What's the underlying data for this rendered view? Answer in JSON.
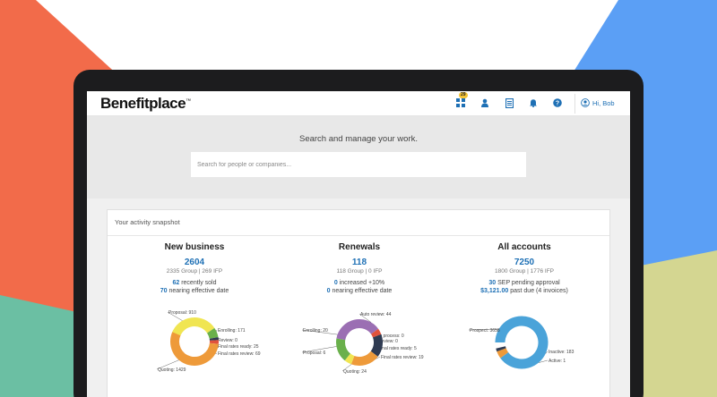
{
  "app": {
    "logo": "Benefitplace",
    "logo_mark": "™"
  },
  "header": {
    "badge": "29",
    "user_label": "Hi, Bob"
  },
  "hero": {
    "title": "Search and manage your work.",
    "search_placeholder": "Search for people or companies..."
  },
  "snapshot": {
    "title": "Your activity snapshot",
    "new_business": {
      "title": "New business",
      "count": "2604",
      "sub": "2335 Group | 269 IFP",
      "line1_num": "62",
      "line1_text": " recently sold",
      "line2_num": "70",
      "line2_text": " nearing effective date",
      "segments": [
        {
          "label": "Proposal: 910",
          "value": 910,
          "color": "#f0e552"
        },
        {
          "label": "Enrolling: 171",
          "value": 171,
          "color": "#6ab04c"
        },
        {
          "label": "Review: 0",
          "value": 0,
          "color": "#999999"
        },
        {
          "label": "Final rates ready: 25",
          "value": 25,
          "color": "#2f3b52"
        },
        {
          "label": "Final rates review: 69",
          "value": 69,
          "color": "#e0523c"
        },
        {
          "label": "Quoting: 1429",
          "value": 1429,
          "color": "#ee9a3a"
        }
      ]
    },
    "renewals": {
      "title": "Renewals",
      "count": "118",
      "sub": "118 Group | 0 IFP",
      "line1_num": "0",
      "line1_text": " increased +10%",
      "line2_num": "0",
      "line2_text": " nearing effective date",
      "segments": [
        {
          "label": "Auto review: 44",
          "value": 44,
          "color": "#9b6fb3"
        },
        {
          "label": "In process: 0",
          "value": 0,
          "color": "#999999"
        },
        {
          "label": "Review: 0",
          "value": 0,
          "color": "#999999"
        },
        {
          "label": "Final rates ready: 5",
          "value": 5,
          "color": "#e0523c"
        },
        {
          "label": "Final rates review: 19",
          "value": 19,
          "color": "#2f3b52"
        },
        {
          "label": "Quoting: 24",
          "value": 24,
          "color": "#ee9a3a"
        },
        {
          "label": "Proposal: 6",
          "value": 6,
          "color": "#f0e552"
        },
        {
          "label": "Enrolling: 20",
          "value": 20,
          "color": "#6ab04c"
        }
      ]
    },
    "all_accounts": {
      "title": "All accounts",
      "count": "7250",
      "sub": "1800 Group | 1776 IFP",
      "line1_num": "30",
      "line1_text": " SEP pending approval",
      "line2_num": "$3,121.00",
      "line2_text": " past due (4 invoices)",
      "segments": [
        {
          "label": "Prospect: 3658",
          "value": 3658,
          "color": "#4aa3d9"
        },
        {
          "label": "Inactive: 183",
          "value": 183,
          "color": "#ee9a3a"
        },
        {
          "label": "Active: 1",
          "value": 1,
          "color": "#2f3b52"
        }
      ]
    }
  },
  "colors": {
    "accent": "#1e70b5",
    "hero_bg": "#e8e8e8"
  }
}
